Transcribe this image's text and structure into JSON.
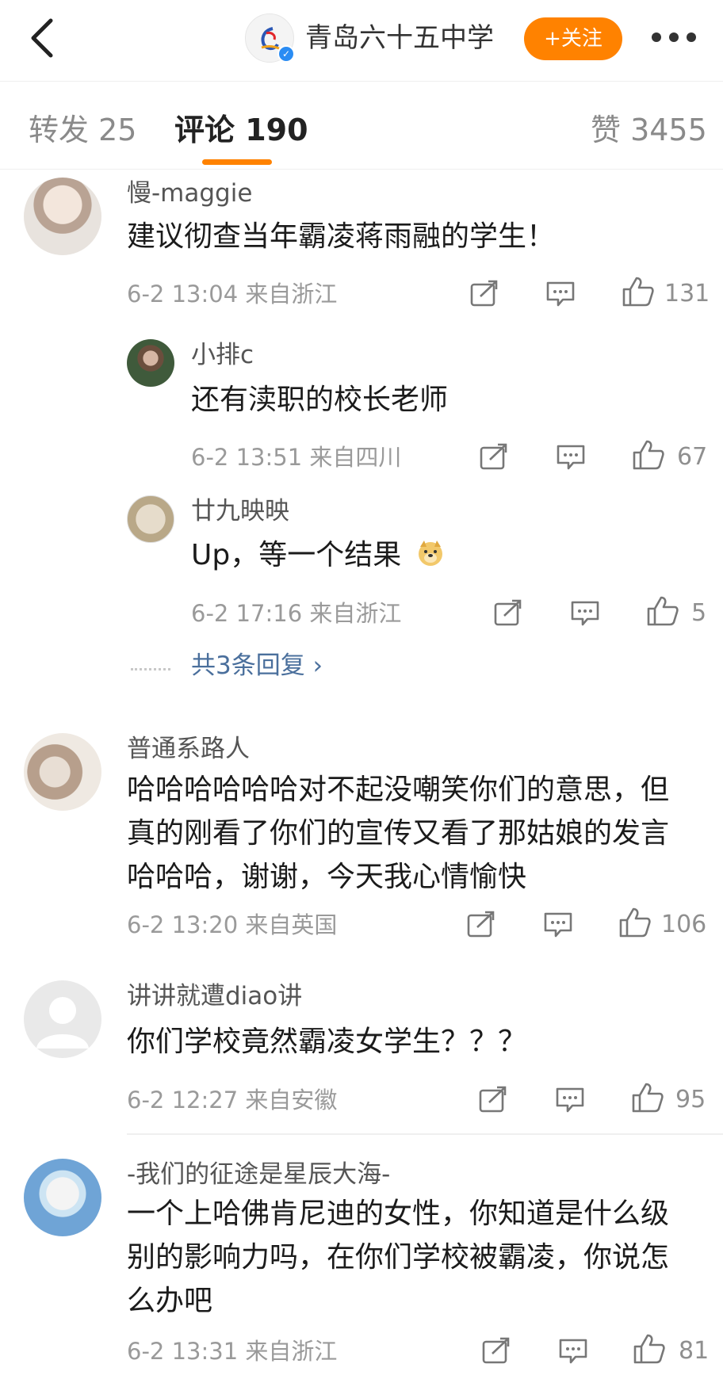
{
  "header": {
    "account_name": "青岛六十五中学",
    "follow_label": "+关注"
  },
  "tabs": [
    {
      "label": "转发 25"
    },
    {
      "label": "评论 190"
    },
    {
      "label": "赞 3455"
    }
  ],
  "comments": [
    {
      "user": "慢-maggie",
      "text": [
        "建议彻查当年霸凌蒋雨融的学生！"
      ],
      "meta": "6-2 13:04  来自浙江",
      "likes": "131",
      "replies": [
        {
          "user": "小排c",
          "text": "还有渎职的校长老师",
          "meta": "6-2 13:51  来自四川",
          "likes": "67"
        },
        {
          "user": "廿九映映",
          "text": "Up，等一个结果",
          "meta": "6-2 17:16  来自浙江",
          "likes": "5"
        }
      ],
      "more_replies": "共3条回复 ›"
    },
    {
      "user": "普通系路人",
      "text": [
        "哈哈哈哈哈哈对不起没嘲笑你们的意思，但",
        "真的刚看了你们的宣传又看了那姑娘的发言",
        "哈哈哈，谢谢，今天我心情愉快"
      ],
      "meta": "6-2 13:20  来自英国",
      "likes": "106"
    },
    {
      "user": "讲讲就遭diao讲",
      "text": [
        "你们学校竟然霸凌女学生？？？"
      ],
      "meta": "6-2 12:27  来自安徽",
      "likes": "95"
    },
    {
      "user": "-我们的征途是星辰大海-",
      "text": [
        "一个上哈佛肯尼迪的女性，你知道是什么级",
        "别的影响力吗，在你们学校被霸凌，你说怎",
        "么办吧"
      ],
      "meta": "6-2 13:31  来自浙江",
      "likes": "81"
    }
  ],
  "colors": {
    "accent": "#ff8200",
    "link": "#4a6f9c",
    "verified": "#2a8cf3"
  }
}
